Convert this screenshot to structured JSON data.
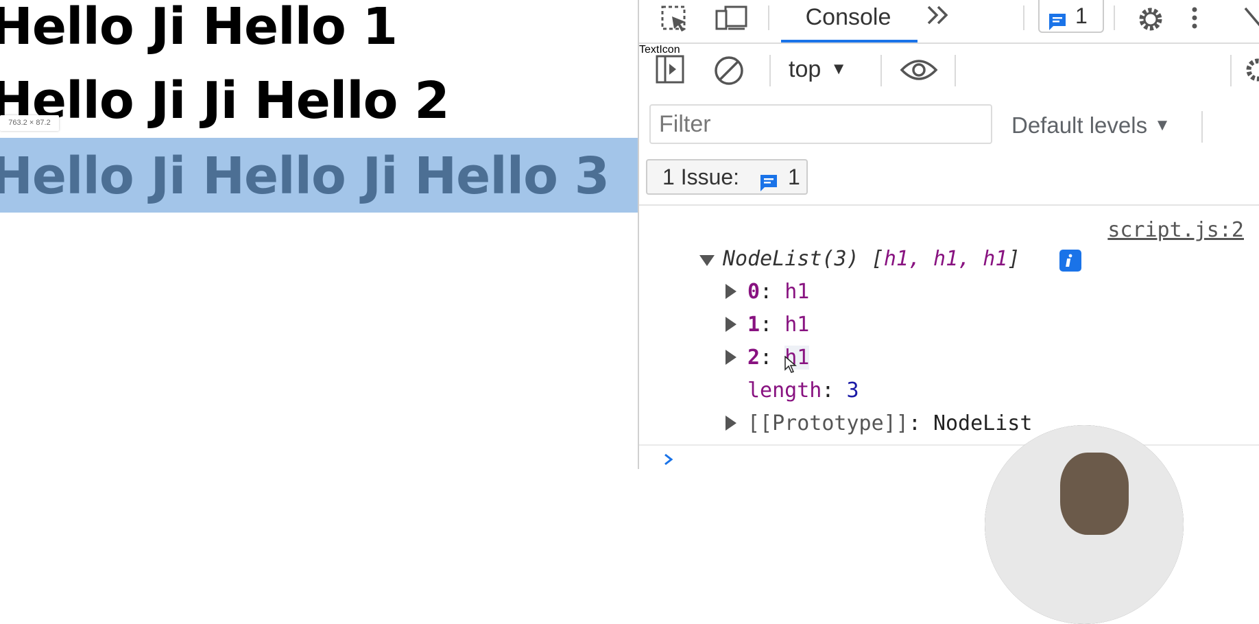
{
  "viewport": {
    "headings": [
      "Hello Ji Hello 1",
      "Hello Ji Ji Hello 2",
      "Hello Ji Hello Ji Hello 3"
    ],
    "dimension_tooltip": "763.2 × 87.2",
    "highlight_color": "#a3c5e9"
  },
  "devtools": {
    "tabs": {
      "active": "Console",
      "issue_count": "1"
    },
    "toolbar": {
      "context": "top"
    },
    "filter": {
      "placeholder": "Filter",
      "levels": "Default levels"
    },
    "issues": {
      "label": "1 Issue:",
      "count": "1"
    },
    "output": {
      "source": "script.js:2",
      "summary_prefix": "NodeList(3) [",
      "summary_items": "h1, h1, h1",
      "summary_suffix": "]",
      "entries": [
        {
          "key": "0",
          "value": "h1"
        },
        {
          "key": "1",
          "value": "h1"
        },
        {
          "key": "2",
          "value": "h1"
        }
      ],
      "length_key": "length",
      "length_value": "3",
      "prototype_key": "[[Prototype]]",
      "prototype_value": "NodeList"
    },
    "accent_color": "#1a73e8"
  }
}
